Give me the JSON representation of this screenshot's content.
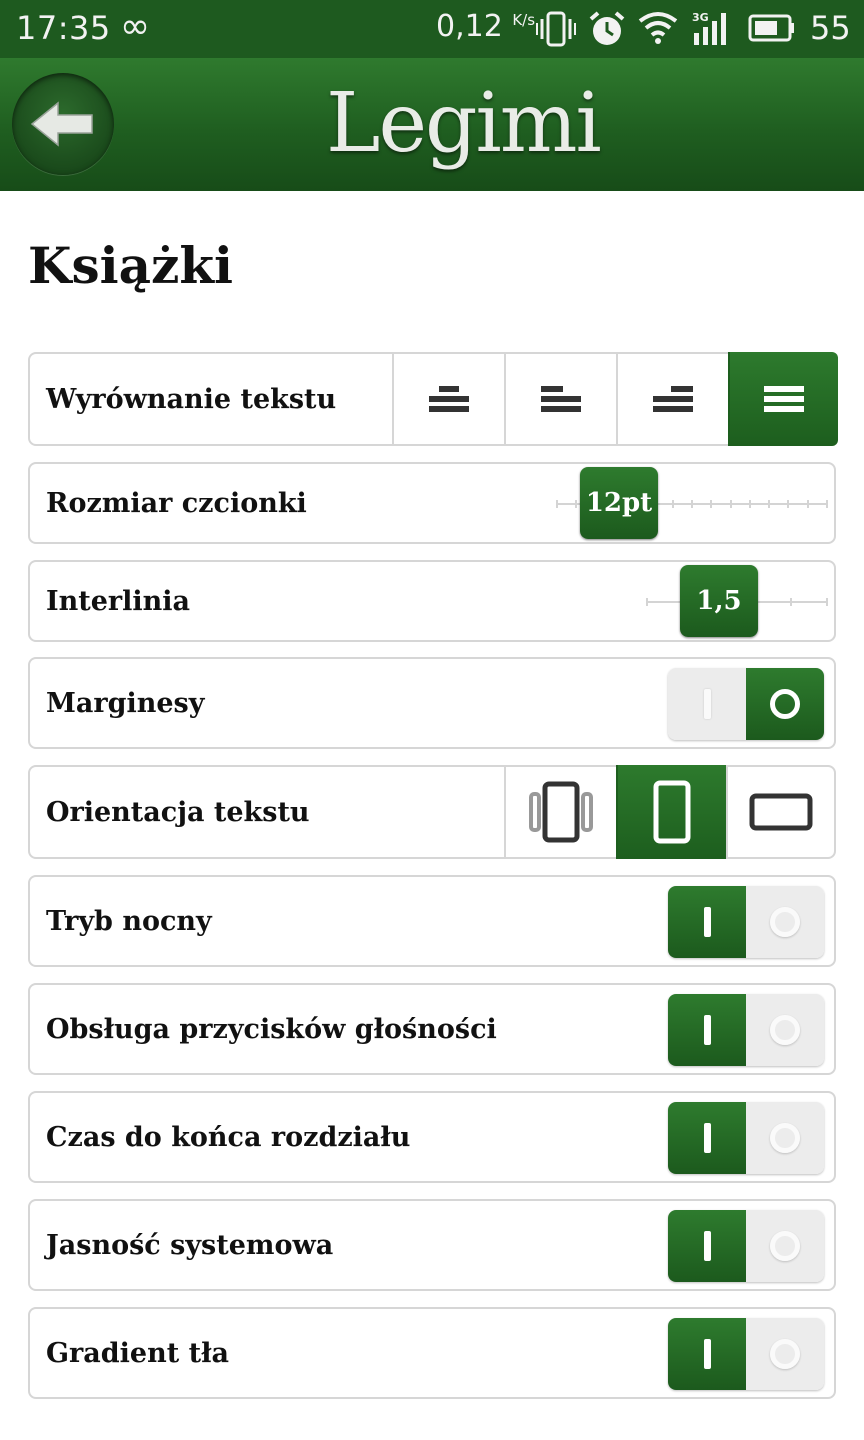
{
  "status_bar": {
    "time": "17:35",
    "infinity": "∞",
    "speed": "0,12",
    "speed_unit": "K/s",
    "battery": "55"
  },
  "header": {
    "logo_text": "Legimi",
    "back_icon": "arrow-left-icon"
  },
  "page": {
    "title": "Książki"
  },
  "settings": {
    "text_alignment": {
      "label": "Wyrównanie tekstu",
      "options": [
        "center",
        "left",
        "right",
        "justify"
      ],
      "selected": "justify"
    },
    "font_size": {
      "label": "Rozmiar czcionki",
      "value": "12pt",
      "level": 0.15
    },
    "line_spacing": {
      "label": "Interlinia",
      "value": "1,5",
      "level": 0.55
    },
    "margins": {
      "label": "Marginesy",
      "on": false
    },
    "orientation": {
      "label": "Orientacja tekstu",
      "options": [
        "auto-rotate",
        "portrait",
        "landscape"
      ],
      "selected": "portrait"
    },
    "night_mode": {
      "label": "Tryb nocny",
      "on": true
    },
    "volume_keys": {
      "label": "Obsługa przycisków głośności",
      "on": true
    },
    "chapter_time": {
      "label": "Czas do końca rozdziału",
      "on": true
    },
    "system_brightness": {
      "label": "Jasność systemowa",
      "on": true
    },
    "bg_gradient": {
      "label": "Gradient tła",
      "on": true
    }
  },
  "colors": {
    "accent_green": "#1f5e20",
    "status_bar": "#1e5a1f"
  }
}
